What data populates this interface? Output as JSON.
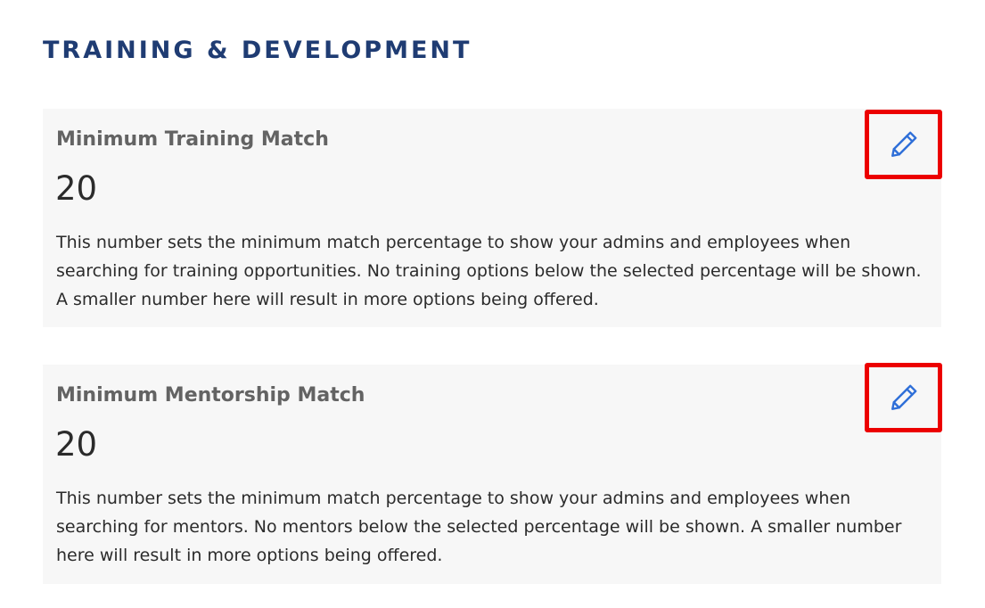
{
  "section": {
    "title": "TRAINING & DEVELOPMENT"
  },
  "cards": [
    {
      "title": "Minimum Training Match",
      "value": "20",
      "description": "This number sets the minimum match percentage to show your admins and employees when searching for training opportunities. No training options below the selected percentage will be shown. A smaller number here will result in more options being offered.",
      "edit_icon": "pencil-icon"
    },
    {
      "title": "Minimum Mentorship Match",
      "value": "20",
      "description": "This number sets the minimum match percentage to show your admins and employees when searching for mentors. No mentors below the selected percentage will be shown. A smaller number here will result in more options being offered.",
      "edit_icon": "pencil-icon"
    }
  ],
  "colors": {
    "title": "#1f3c73",
    "card_background": "#f7f7f7",
    "highlight_border": "#ec0000",
    "icon": "#2f6fd8"
  }
}
